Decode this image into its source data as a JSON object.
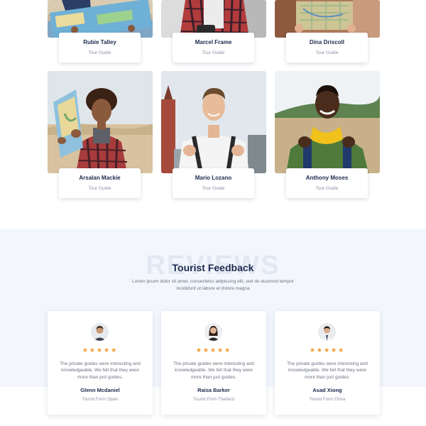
{
  "guides": [
    {
      "name": "Rubie Talley",
      "role": "Tour Guide"
    },
    {
      "name": "Marcel Frame",
      "role": "Tour Guide"
    },
    {
      "name": "Dina Driscoll",
      "role": "Tour Guide"
    },
    {
      "name": "Arsalan Mackie",
      "role": "Tour Guide"
    },
    {
      "name": "Mario Lozano",
      "role": "Tour Guide"
    },
    {
      "name": "Anthony Moses",
      "role": "Tour Guide"
    }
  ],
  "reviews_section": {
    "background_word": "REVIEWS",
    "title": "Tourist Feedback",
    "description": "Lorem ipsum dolor sit amet, consectetur adipiscing elit, sed do eiusmod tempor incididunt ut labore et dolore magna"
  },
  "reviews": [
    {
      "stars": "★★★★★",
      "text": "The private guides were interesting and knowledgeable. We felt that they were more than just guides.",
      "name": "Glenn Mcdaniel",
      "from": "Tourist Form Spain"
    },
    {
      "stars": "★★★★★",
      "text": "The private guides were interesting and knowledgeable. We felt that they were more than just guides.",
      "name": "Raisa Barker",
      "from": "Tourist From Thailand"
    },
    {
      "stars": "★★★★★",
      "text": "The private guides were interesting and knowledgeable. We felt that they were more than just guides.",
      "name": "Asad Xiong",
      "from": "Tourist Form China"
    }
  ],
  "colors": {
    "navy": "#1b2a4e",
    "star": "#f29a2e",
    "section_bg": "#f3f7fd"
  }
}
